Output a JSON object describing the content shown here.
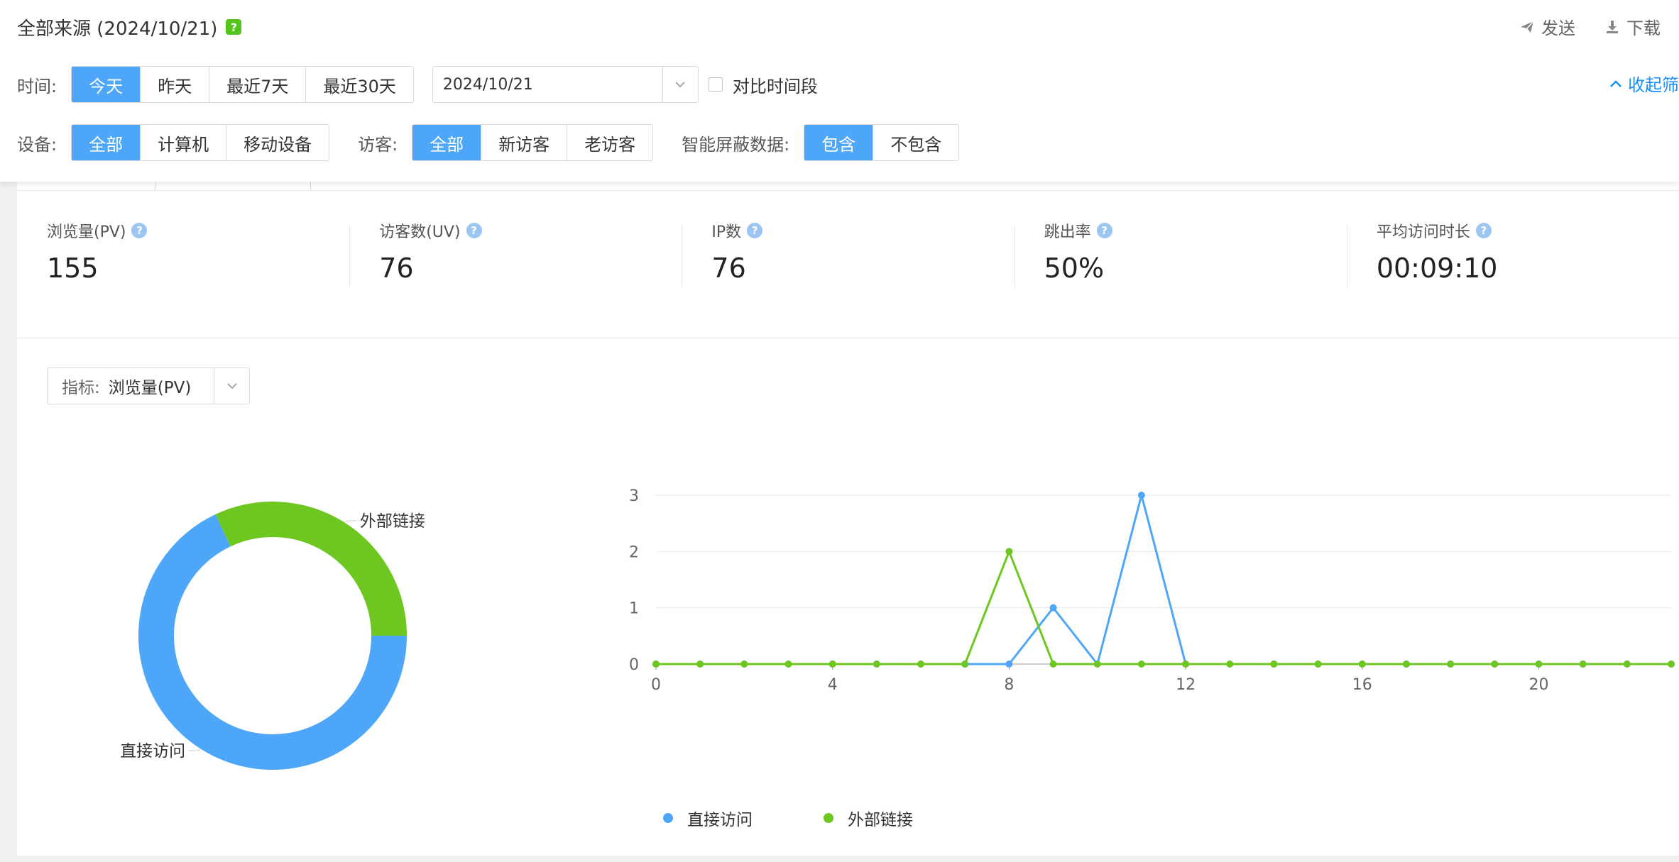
{
  "header": {
    "title": "全部来源 (2024/10/21)",
    "help_badge": "?",
    "send_label": "发送",
    "download_label": "下载"
  },
  "filters": {
    "time_label": "时间:",
    "time_options": [
      "今天",
      "昨天",
      "最近7天",
      "最近30天"
    ],
    "time_selected": "今天",
    "date_value": "2024/10/21",
    "compare_label": "对比时间段",
    "collapse_label": "收起筛",
    "device_label": "设备:",
    "device_options": [
      "全部",
      "计算机",
      "移动设备"
    ],
    "device_selected": "全部",
    "visitor_label": "访客:",
    "visitor_options": [
      "全部",
      "新访客",
      "老访客"
    ],
    "visitor_selected": "全部",
    "block_label": "智能屏蔽数据:",
    "block_options": [
      "包含",
      "不包含"
    ],
    "block_selected": "包含"
  },
  "metrics": [
    {
      "name": "浏览量(PV)",
      "value": "155"
    },
    {
      "name": "访客数(UV)",
      "value": "76"
    },
    {
      "name": "IP数",
      "value": "76"
    },
    {
      "name": "跳出率",
      "value": "50%"
    },
    {
      "name": "平均访问时长",
      "value": "00:09:10"
    }
  ],
  "indicator": {
    "label": "指标:",
    "value": "浏览量(PV)"
  },
  "colors": {
    "accent": "#4ea6f8",
    "direct": "#4ea6f8",
    "external": "#6ec620"
  },
  "chart_data": [
    {
      "type": "pie",
      "style": "donut",
      "categories": [
        "直接访问",
        "外部链接"
      ],
      "values": [
        68,
        32
      ]
    },
    {
      "type": "line",
      "x": [
        0,
        1,
        2,
        3,
        4,
        5,
        6,
        7,
        8,
        9,
        10,
        11,
        12,
        13,
        14,
        15,
        16,
        17,
        18,
        19,
        20,
        21,
        22,
        23
      ],
      "xticks": [
        0,
        4,
        8,
        12,
        16,
        20
      ],
      "yticks": [
        0,
        1,
        2,
        3
      ],
      "ylim": [
        0,
        3
      ],
      "grid": true,
      "legend": "bottom-left",
      "series": [
        {
          "name": "直接访问",
          "color": "#4ea6f8",
          "values": [
            0,
            0,
            0,
            0,
            0,
            0,
            0,
            0,
            0,
            1,
            0,
            3,
            0,
            0,
            0,
            0,
            0,
            0,
            0,
            0,
            0,
            0,
            0,
            0
          ]
        },
        {
          "name": "外部链接",
          "color": "#6ec620",
          "values": [
            0,
            0,
            0,
            0,
            0,
            0,
            0,
            0,
            2,
            0,
            0,
            0,
            0,
            0,
            0,
            0,
            0,
            0,
            0,
            0,
            0,
            0,
            0,
            0
          ]
        }
      ]
    }
  ]
}
